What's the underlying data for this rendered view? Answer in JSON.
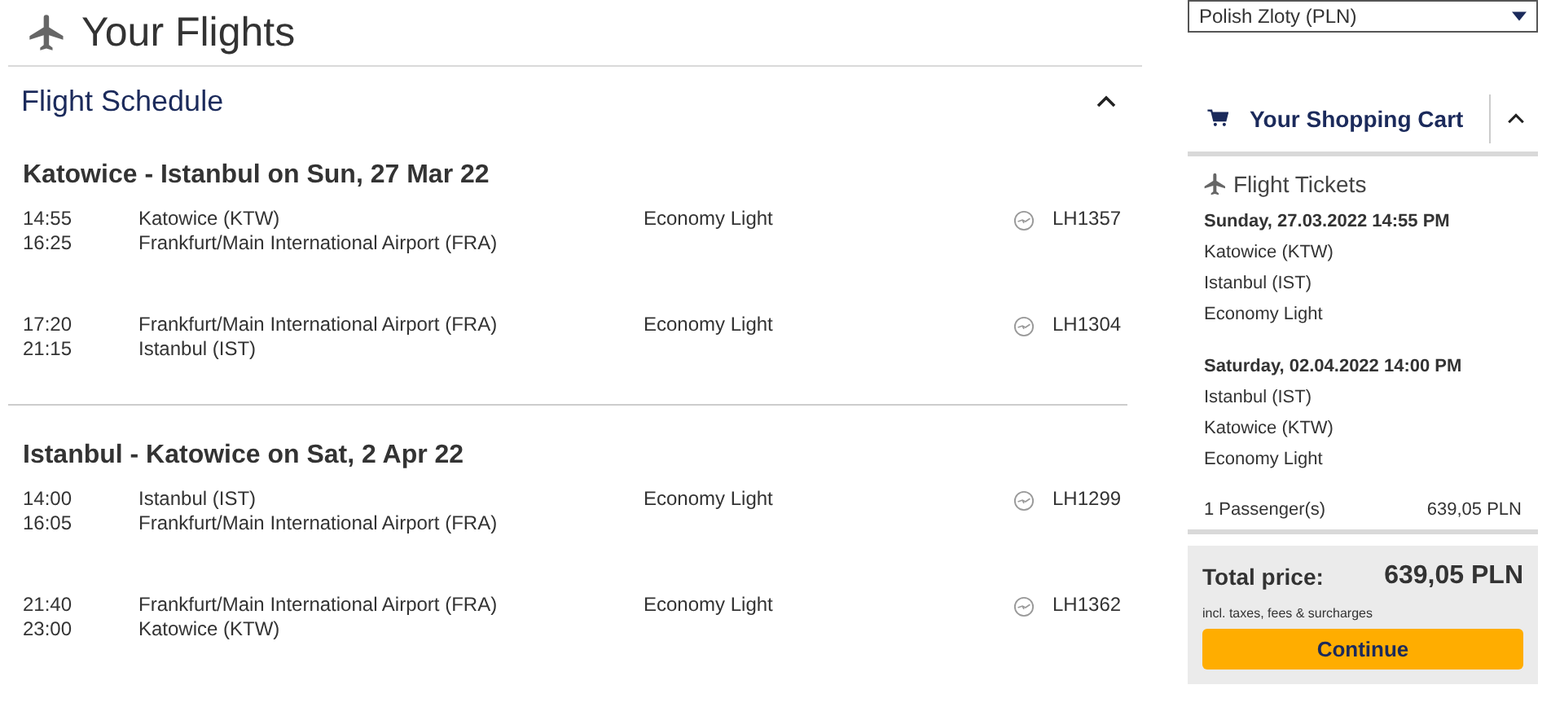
{
  "page_title": "Your Flights",
  "schedule": {
    "title": "Flight Schedule",
    "expanded": true,
    "journeys": [
      {
        "heading": "Katowice - Istanbul on Sun, 27 Mar 22",
        "segments": [
          {
            "departure_time": "14:55",
            "arrival_time": "16:25",
            "from": "Katowice (KTW)",
            "to": "Frankfurt/Main International Airport (FRA)",
            "fare": "Economy Light",
            "flight": "LH1357"
          },
          {
            "departure_time": "17:20",
            "arrival_time": "21:15",
            "from": "Frankfurt/Main International Airport (FRA)",
            "to": "Istanbul (IST)",
            "fare": "Economy Light",
            "flight": "LH1304"
          }
        ]
      },
      {
        "heading": "Istanbul - Katowice on Sat, 2 Apr 22",
        "segments": [
          {
            "departure_time": "14:00",
            "arrival_time": "16:05",
            "from": "Istanbul (IST)",
            "to": "Frankfurt/Main International Airport (FRA)",
            "fare": "Economy Light",
            "flight": "LH1299"
          },
          {
            "departure_time": "21:40",
            "arrival_time": "23:00",
            "from": "Frankfurt/Main International Airport (FRA)",
            "to": "Katowice (KTW)",
            "fare": "Economy Light",
            "flight": "LH1362"
          }
        ]
      }
    ]
  },
  "currency_select": {
    "value": "Polish Zloty (PLN)"
  },
  "cart": {
    "title": "Your Shopping Cart",
    "expanded": true,
    "section_title": "Flight Tickets",
    "items": [
      {
        "date": "Sunday, 27.03.2022 14:55 PM",
        "from": "Katowice (KTW)",
        "to": "Istanbul (IST)",
        "fare": "Economy Light"
      },
      {
        "date": "Saturday, 02.04.2022 14:00 PM",
        "from": "Istanbul (IST)",
        "to": "Katowice (KTW)",
        "fare": "Economy Light"
      }
    ],
    "passengers": "1 Passenger(s)",
    "passengers_price": "639,05 PLN",
    "total_label": "Total price:",
    "total_price": "639,05 PLN",
    "total_note": "incl. taxes, fees & surcharges",
    "continue_button": "Continue"
  }
}
